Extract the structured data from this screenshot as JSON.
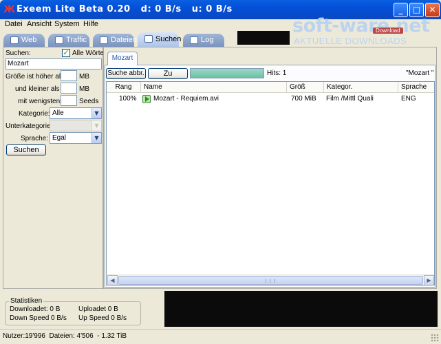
{
  "window": {
    "title": "Exeem Lite Beta 0.20",
    "download_speed": "d: 0 B/s",
    "upload_speed": "u: 0 B/s",
    "minimize": "_",
    "maximize": "□",
    "close": "✕"
  },
  "menu": [
    "Datei",
    "Ansicht",
    "System",
    "Hilfe"
  ],
  "tabs": [
    {
      "label": "Web",
      "icon": "globe-icon",
      "active": false
    },
    {
      "label": "Traffic",
      "icon": "traffic-icon",
      "active": false
    },
    {
      "label": "Dateien",
      "icon": "files-icon",
      "active": false
    },
    {
      "label": "Suchen",
      "icon": "search-icon",
      "active": true
    },
    {
      "label": "Log",
      "icon": "log-icon",
      "active": false
    }
  ],
  "watermark": {
    "main": "soft-ware.net",
    "sub": "AKTUELLE DOWNLOADS",
    "badge": "Download"
  },
  "search_panel": {
    "search_label": "Suchen:",
    "all_words_label": "Alle Wörter",
    "all_words_checked": true,
    "search_value": "Mozart",
    "size_greater_label": "Größe ist höher als",
    "size_greater_value": "",
    "size_greater_unit": "MB",
    "size_smaller_label": "und kleiner als",
    "size_smaller_value": "",
    "size_smaller_unit": "MB",
    "min_seeds_label": "mit wenigstens",
    "min_seeds_value": "",
    "min_seeds_unit": "Seeds",
    "category_label": "Kategorie:",
    "category_value": "Alle",
    "subcategory_label": "Unterkategorie:",
    "subcategory_value": "",
    "language_label": "Sprache:",
    "language_value": "Egal",
    "search_button": "Suchen"
  },
  "results": {
    "tab_label": "Mozart",
    "cancel_button": "Suche abbr.",
    "close_button": "Zu",
    "progress": 1.0,
    "hits": "Hits: 1",
    "query": "\"Mozart \"",
    "columns": [
      "Rang",
      "Name",
      "Größ",
      "Kategor.",
      "Sprache"
    ],
    "rows": [
      {
        "rank": "100%",
        "name": "Mozart - Requiem.avi",
        "size": "700 MiB",
        "category": "Film  /Mittl Quali",
        "language": "ENG"
      }
    ]
  },
  "stats": {
    "title": "Statistiken",
    "downloaded": "Downloadet: 0 B",
    "uploaded": "Uploadet  0 B",
    "down_speed": "Down Speed 0 B/s",
    "up_speed": "Up Speed 0 B/s"
  },
  "statusbar": {
    "text": "Nutzer:19'996  Dateien: 4'506  - 1.32 TiB"
  },
  "colors": {
    "titlebar": "#0a5fe0",
    "progress_fill": "#6cbfa5",
    "tab_inactive": "#7b93bd"
  }
}
